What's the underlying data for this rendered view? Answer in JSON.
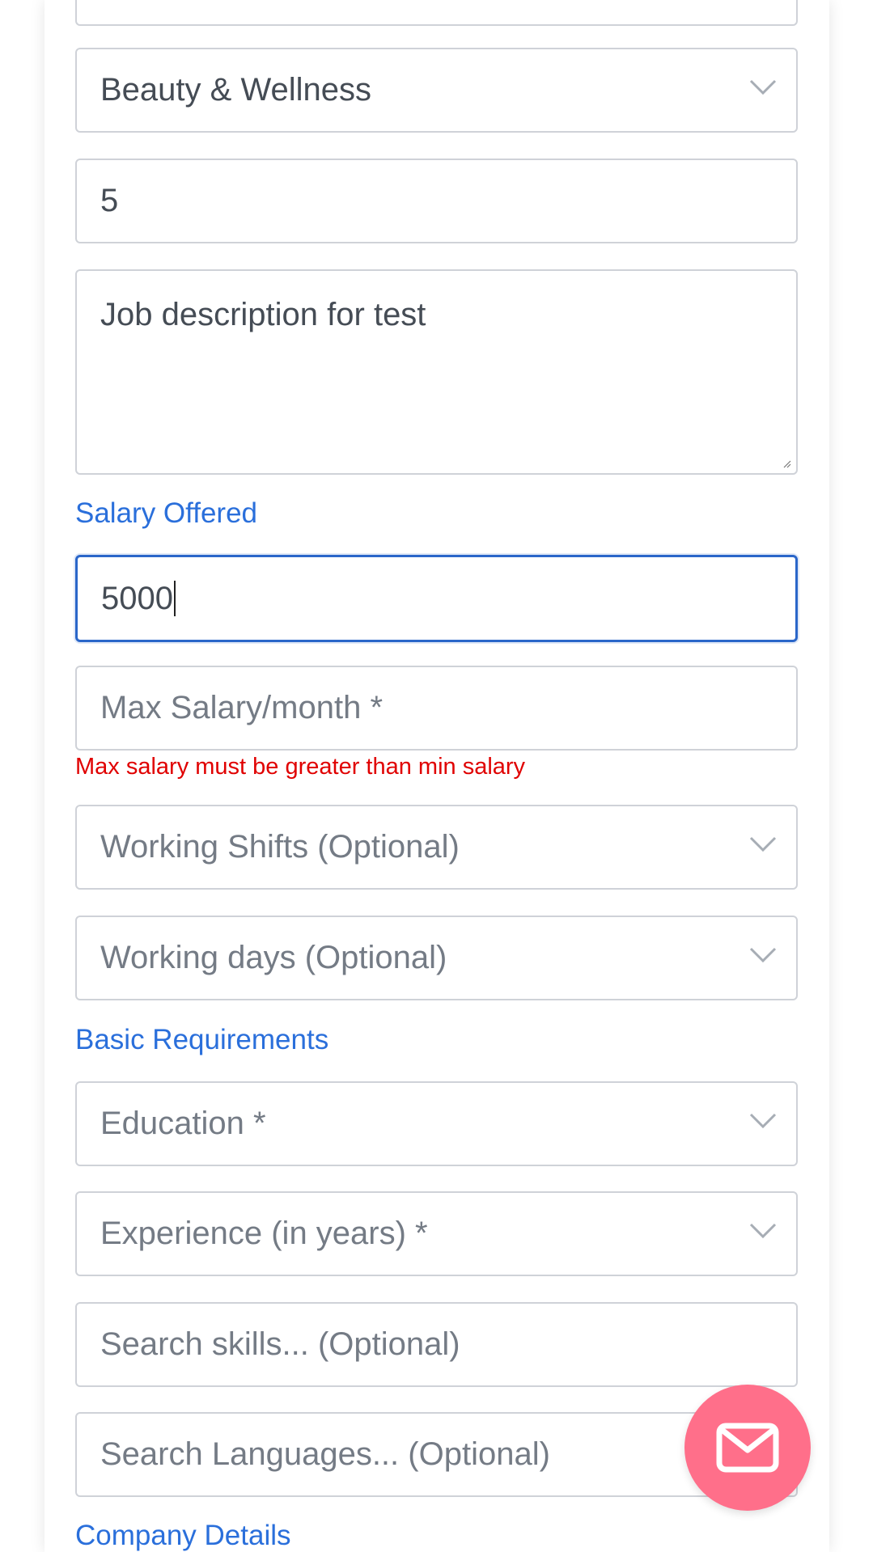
{
  "form": {
    "category_select": {
      "value": "Beauty & Wellness"
    },
    "openings_input": {
      "value": "5"
    },
    "description_textarea": {
      "value": "Job description for test"
    },
    "salary_section_label": "Salary Offered",
    "min_salary_input": {
      "value": "5000"
    },
    "max_salary_input": {
      "placeholder": "Max Salary/month *"
    },
    "max_salary_error": "Max salary must be greater than min salary",
    "working_shifts_select": {
      "placeholder": "Working Shifts (Optional)"
    },
    "working_days_select": {
      "placeholder": "Working days (Optional)"
    },
    "requirements_section_label": "Basic Requirements",
    "education_select": {
      "placeholder": "Education *"
    },
    "experience_select": {
      "placeholder": "Experience (in years) *"
    },
    "skills_search": {
      "placeholder": "Search skills... (Optional)"
    },
    "languages_search": {
      "placeholder": "Search Languages... (Optional)"
    },
    "company_section_label": "Company Details"
  },
  "fab": {
    "icon": "mail-icon"
  },
  "colors": {
    "accent": "#2a6fdb",
    "focus_border": "#2a66c9",
    "error": "#e00000",
    "fab": "#ff6f8a"
  }
}
